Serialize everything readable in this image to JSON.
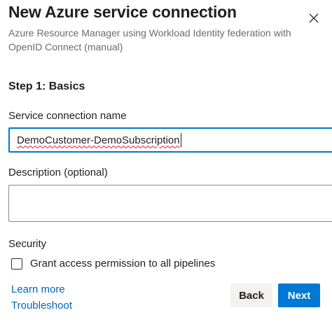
{
  "dialog": {
    "title": "New Azure service connection",
    "subtitle": "Azure Resource Manager using Workload Identity federation with OpenID Connect (manual)",
    "close_icon": "close-icon"
  },
  "step": {
    "heading": "Step 1: Basics"
  },
  "service_connection_name": {
    "label": "Service connection name",
    "value": "DemoCustomer-DemoSubscription"
  },
  "description": {
    "label": "Description (optional)",
    "value": ""
  },
  "security": {
    "label": "Security",
    "grant_access": {
      "label": "Grant access permission to all pipelines",
      "checked": false
    }
  },
  "links": {
    "learn_more": "Learn more",
    "troubleshoot": "Troubleshoot"
  },
  "buttons": {
    "back": "Back",
    "next": "Next"
  },
  "colors": {
    "primary": "#0078d4",
    "link": "#0067b8",
    "secondary_button": "#f3f2f1"
  }
}
